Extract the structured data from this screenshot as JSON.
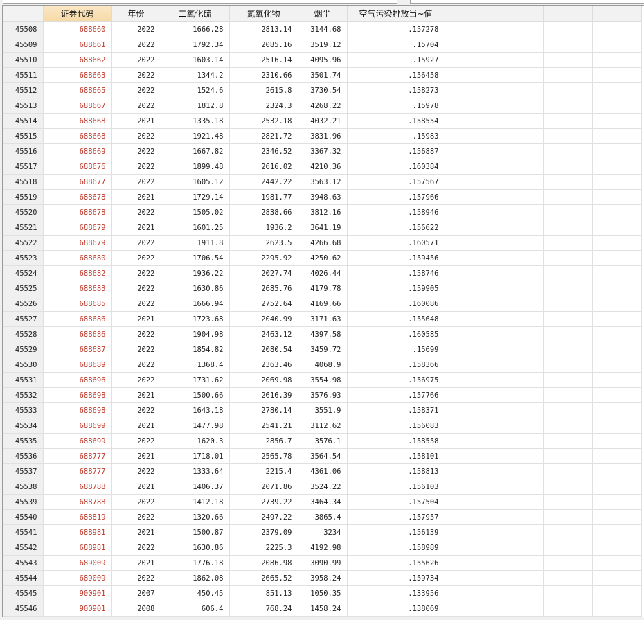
{
  "columns": [
    "证券代码",
    "年份",
    "二氧化硫",
    "氮氧化物",
    "烟尘",
    "空气污染排放当~值"
  ],
  "empty_column_count": 4,
  "colors": {
    "code_text": "#c0392b",
    "selected_header": "#f6d9a6"
  },
  "rows": [
    [
      "45508",
      "688660",
      "2022",
      "1666.28",
      "2813.14",
      "3144.68",
      ".157278"
    ],
    [
      "45509",
      "688661",
      "2022",
      "1792.34",
      "2085.16",
      "3519.12",
      ".15704"
    ],
    [
      "45510",
      "688662",
      "2022",
      "1603.14",
      "2516.14",
      "4095.96",
      ".15927"
    ],
    [
      "45511",
      "688663",
      "2022",
      "1344.2",
      "2310.66",
      "3501.74",
      ".156458"
    ],
    [
      "45512",
      "688665",
      "2022",
      "1524.6",
      "2615.8",
      "3730.54",
      ".158273"
    ],
    [
      "45513",
      "688667",
      "2022",
      "1812.8",
      "2324.3",
      "4268.22",
      ".15978"
    ],
    [
      "45514",
      "688668",
      "2021",
      "1335.18",
      "2532.18",
      "4032.21",
      ".158554"
    ],
    [
      "45515",
      "688668",
      "2022",
      "1921.48",
      "2821.72",
      "3831.96",
      ".15983"
    ],
    [
      "45516",
      "688669",
      "2022",
      "1667.82",
      "2346.52",
      "3367.32",
      ".156887"
    ],
    [
      "45517",
      "688676",
      "2022",
      "1899.48",
      "2616.02",
      "4210.36",
      ".160384"
    ],
    [
      "45518",
      "688677",
      "2022",
      "1605.12",
      "2442.22",
      "3563.12",
      ".157567"
    ],
    [
      "45519",
      "688678",
      "2021",
      "1729.14",
      "1981.77",
      "3948.63",
      ".157966"
    ],
    [
      "45520",
      "688678",
      "2022",
      "1505.02",
      "2838.66",
      "3812.16",
      ".158946"
    ],
    [
      "45521",
      "688679",
      "2021",
      "1601.25",
      "1936.2",
      "3641.19",
      ".156622"
    ],
    [
      "45522",
      "688679",
      "2022",
      "1911.8",
      "2623.5",
      "4266.68",
      ".160571"
    ],
    [
      "45523",
      "688680",
      "2022",
      "1706.54",
      "2295.92",
      "4250.62",
      ".159456"
    ],
    [
      "45524",
      "688682",
      "2022",
      "1936.22",
      "2027.74",
      "4026.44",
      ".158746"
    ],
    [
      "45525",
      "688683",
      "2022",
      "1630.86",
      "2685.76",
      "4179.78",
      ".159905"
    ],
    [
      "45526",
      "688685",
      "2022",
      "1666.94",
      "2752.64",
      "4169.66",
      ".160086"
    ],
    [
      "45527",
      "688686",
      "2021",
      "1723.68",
      "2040.99",
      "3171.63",
      ".155648"
    ],
    [
      "45528",
      "688686",
      "2022",
      "1904.98",
      "2463.12",
      "4397.58",
      ".160585"
    ],
    [
      "45529",
      "688687",
      "2022",
      "1854.82",
      "2080.54",
      "3459.72",
      ".15699"
    ],
    [
      "45530",
      "688689",
      "2022",
      "1368.4",
      "2363.46",
      "4068.9",
      ".158366"
    ],
    [
      "45531",
      "688696",
      "2022",
      "1731.62",
      "2069.98",
      "3554.98",
      ".156975"
    ],
    [
      "45532",
      "688698",
      "2021",
      "1500.66",
      "2616.39",
      "3576.93",
      ".157766"
    ],
    [
      "45533",
      "688698",
      "2022",
      "1643.18",
      "2780.14",
      "3551.9",
      ".158371"
    ],
    [
      "45534",
      "688699",
      "2021",
      "1477.98",
      "2541.21",
      "3112.62",
      ".156083"
    ],
    [
      "45535",
      "688699",
      "2022",
      "1620.3",
      "2856.7",
      "3576.1",
      ".158558"
    ],
    [
      "45536",
      "688777",
      "2021",
      "1718.01",
      "2565.78",
      "3564.54",
      ".158101"
    ],
    [
      "45537",
      "688777",
      "2022",
      "1333.64",
      "2215.4",
      "4361.06",
      ".158813"
    ],
    [
      "45538",
      "688788",
      "2021",
      "1406.37",
      "2071.86",
      "3524.22",
      ".156103"
    ],
    [
      "45539",
      "688788",
      "2022",
      "1412.18",
      "2739.22",
      "3464.34",
      ".157504"
    ],
    [
      "45540",
      "688819",
      "2022",
      "1320.66",
      "2497.22",
      "3865.4",
      ".157957"
    ],
    [
      "45541",
      "688981",
      "2021",
      "1500.87",
      "2379.09",
      "3234",
      ".156139"
    ],
    [
      "45542",
      "688981",
      "2022",
      "1630.86",
      "2225.3",
      "4192.98",
      ".158989"
    ],
    [
      "45543",
      "689009",
      "2021",
      "1776.18",
      "2086.98",
      "3090.99",
      ".155626"
    ],
    [
      "45544",
      "689009",
      "2022",
      "1862.08",
      "2665.52",
      "3958.24",
      ".159734"
    ],
    [
      "45545",
      "900901",
      "2007",
      "450.45",
      "851.13",
      "1050.35",
      ".133956"
    ],
    [
      "45546",
      "900901",
      "2008",
      "606.4",
      "768.24",
      "1458.24",
      ".138069"
    ]
  ]
}
